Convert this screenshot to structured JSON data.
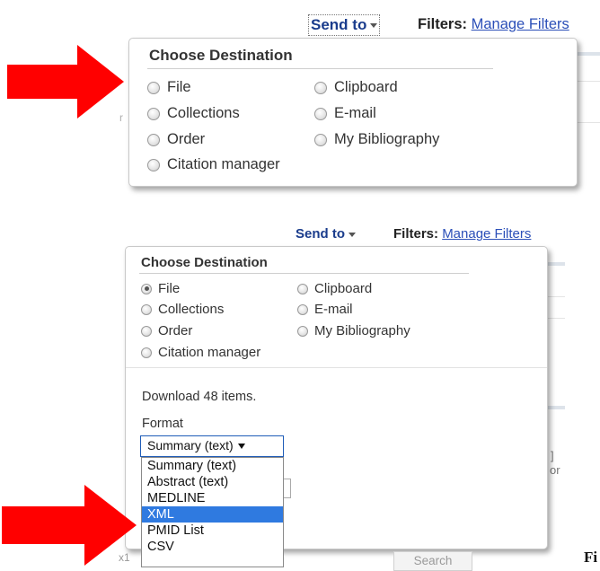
{
  "top": {
    "toolbar": {
      "send_to": "Send to",
      "filters_label": "Filters:",
      "manage_filters": "Manage Filters"
    },
    "panel": {
      "title": "Choose Destination",
      "options": [
        {
          "label": "File",
          "checked": false
        },
        {
          "label": "Clipboard",
          "checked": false
        },
        {
          "label": "Collections",
          "checked": false
        },
        {
          "label": "E-mail",
          "checked": false
        },
        {
          "label": "Order",
          "checked": false
        },
        {
          "label": "My Bibliography",
          "checked": false
        },
        {
          "label": "Citation manager",
          "checked": false
        }
      ]
    }
  },
  "bottom": {
    "toolbar": {
      "send_to": "Send to",
      "filters_label": "Filters:",
      "manage_filters": "Manage Filters"
    },
    "panel": {
      "title": "Choose Destination",
      "options": [
        {
          "label": "File",
          "checked": true
        },
        {
          "label": "Clipboard",
          "checked": false
        },
        {
          "label": "Collections",
          "checked": false
        },
        {
          "label": "E-mail",
          "checked": false
        },
        {
          "label": "Order",
          "checked": false
        },
        {
          "label": "My Bibliography",
          "checked": false
        },
        {
          "label": "Citation manager",
          "checked": false
        }
      ],
      "download_text": "Download 48 items.",
      "format_label": "Format",
      "format_selected": "Summary (text)",
      "format_options": [
        {
          "label": "Summary (text)",
          "selected": false
        },
        {
          "label": "Abstract (text)",
          "selected": false
        },
        {
          "label": "MEDLINE",
          "selected": false
        },
        {
          "label": "XML",
          "selected": true
        },
        {
          "label": "PMID List",
          "selected": false
        },
        {
          "label": "CSV",
          "selected": false
        }
      ]
    },
    "search_button": "Search"
  },
  "figure_label": "Fi",
  "colors": {
    "arrow": "#ff0000",
    "link": "#2b4fb8",
    "selected_option": "#2f7ae0"
  }
}
